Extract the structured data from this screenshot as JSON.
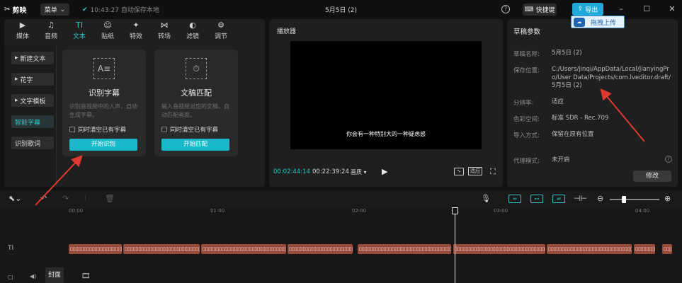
{
  "titlebar": {
    "app_name": "剪映",
    "menu_label": "菜单",
    "autosave": "10:43:27 自动保存本地",
    "doc_title": "5月5日 (2)",
    "shortcut_label": "快捷键",
    "export_label": "导出",
    "drag_upload_label": "拖拽上传"
  },
  "tabs": [
    {
      "label": "媒体",
      "icon": "▶"
    },
    {
      "label": "音频",
      "icon": "♫"
    },
    {
      "label": "文本",
      "icon": "TI"
    },
    {
      "label": "贴纸",
      "icon": "☺"
    },
    {
      "label": "特效",
      "icon": "✦"
    },
    {
      "label": "转场",
      "icon": "⋈"
    },
    {
      "label": "滤镜",
      "icon": "◐"
    },
    {
      "label": "调节",
      "icon": "⚙"
    }
  ],
  "sidenav": [
    {
      "label": "新建文本"
    },
    {
      "label": "花字"
    },
    {
      "label": "文字模板"
    },
    {
      "label": "智能字幕"
    },
    {
      "label": "识别歌词"
    }
  ],
  "cards": [
    {
      "icon": "A≡",
      "title": "识别字幕",
      "desc": "识别音视频中的人声，自动生成字幕。",
      "checkbox": "同时清空已有字幕",
      "button": "开始识别"
    },
    {
      "icon": "⏱",
      "title": "文稿匹配",
      "desc": "输入音视频对应的文稿，自动匹配画面。",
      "checkbox": "同时清空已有字幕",
      "button": "开始匹配"
    }
  ],
  "player": {
    "title": "播放器",
    "subtitle": "你会有一种特别大的一种疑虑感",
    "current_time": "00:02:44:14",
    "total_time": "00:22:39:24",
    "quality": "画质 ▾",
    "ratio": "适应"
  },
  "draft": {
    "title": "草稿参数",
    "name_label": "草稿名称:",
    "name_value": "5月5日 (2)",
    "path_label": "保存位置:",
    "path_value": "C:/Users/jinqi/AppData/Local/JianyingPro/User Data/Projects/com.lveditor.draft/5月5日 (2)",
    "res_label": "分辨率:",
    "res_value": "适应",
    "color_label": "色彩空间:",
    "color_value": "标准 SDR - Rec.709",
    "import_label": "导入方式:",
    "import_value": "保留在原有位置",
    "proxy_label": "代理模式:",
    "proxy_value": "未开启",
    "edit_label": "修改"
  },
  "timeline": {
    "ticks": [
      "00:00",
      "01:00",
      "02:00",
      "03:00",
      "04:00"
    ],
    "cover_label": "封面",
    "track_icon": "TI",
    "clip_text": "▯▯▯▯▯▯▯▯▯▯▯▯▯▯▯▯▯▯▯▯▯▯▯▯▯▯▯▯▯▯▯▯▯▯▯▯▯▯▯▯"
  },
  "colors": {
    "accent": "#2ec4c4",
    "export": "#1fa8d8",
    "clip": "#9a4a3a",
    "arrow": "#e03a30"
  }
}
